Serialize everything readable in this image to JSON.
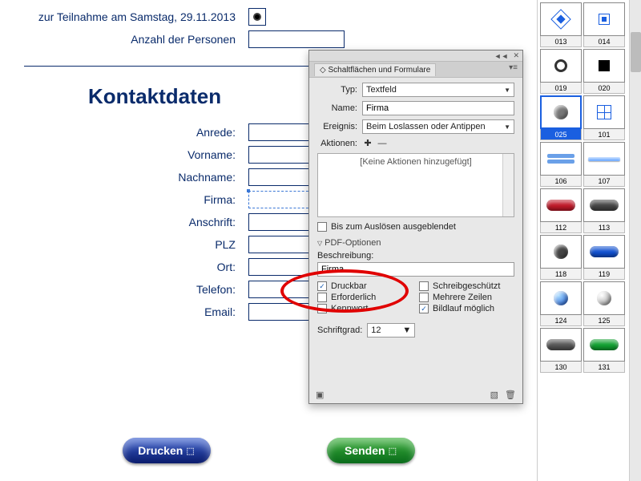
{
  "form": {
    "saturday_label": "zur Teilnahme am Samstag, 29.11.2013",
    "persons_label": "Anzahl der Personen",
    "section_title": "Kontaktdaten",
    "fields": {
      "anrede": "Anrede:",
      "vorname": "Vorname:",
      "nachname": "Nachname:",
      "firma": "Firma:",
      "anschrift": "Anschrift:",
      "plz": "PLZ",
      "ort": "Ort:",
      "telefon": "Telefon:",
      "email": "Email:"
    },
    "buttons": {
      "print": "Drucken",
      "send": "Senden"
    }
  },
  "panel": {
    "tab_title": "Schaltflächen und Formulare",
    "rows": {
      "typ_label": "Typ:",
      "typ_value": "Textfeld",
      "name_label": "Name:",
      "name_value": "Firma",
      "ereignis_label": "Ereignis:",
      "ereignis_value": "Beim Loslassen oder Antippen",
      "aktionen_label": "Aktionen:"
    },
    "actions_placeholder": "[Keine Aktionen hinzugefügt]",
    "hide_until": "Bis zum Auslösen ausgeblendet",
    "pdf_section": "PDF-Optionen",
    "desc_label": "Beschreibung:",
    "desc_value": "Firma",
    "checks": {
      "druckbar": "Druckbar",
      "schreibgeschuetzt": "Schreibgeschützt",
      "erforderlich": "Erforderlich",
      "mehrere": "Mehrere Zeilen",
      "kennwort": "Kennwort",
      "bildlauf": "Bildlauf möglich"
    },
    "checked": {
      "druckbar": true,
      "bildlauf": true
    },
    "font_label": "Schriftgrad:",
    "font_value": "12"
  },
  "library": [
    {
      "id": "013"
    },
    {
      "id": "014"
    },
    {
      "id": "019"
    },
    {
      "id": "020"
    },
    {
      "id": "025",
      "selected": true
    },
    {
      "id": "101"
    },
    {
      "id": "106"
    },
    {
      "id": "107"
    },
    {
      "id": "112"
    },
    {
      "id": "113"
    },
    {
      "id": "118"
    },
    {
      "id": "119"
    },
    {
      "id": "124"
    },
    {
      "id": "125"
    },
    {
      "id": "130"
    },
    {
      "id": "131"
    }
  ]
}
